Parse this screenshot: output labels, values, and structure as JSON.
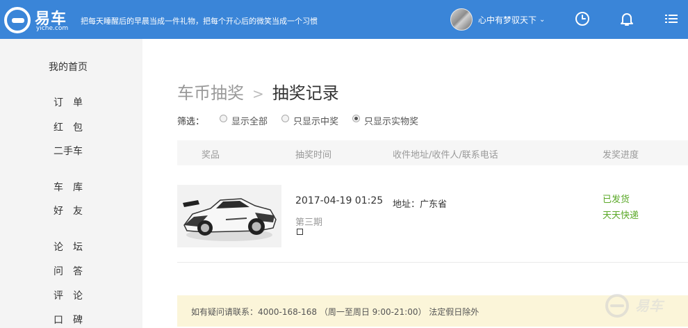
{
  "header": {
    "logo_text": "易车",
    "logo_sub": "yiche.com",
    "slogan": "把每天睡醒后的早晨当成一件礼物，把每个开心后的微笑当成一个习惯",
    "username": "心中有梦驭天下",
    "icons": [
      "clock-icon",
      "bell-icon",
      "menu-icon"
    ]
  },
  "sidebar": {
    "home": "我的首页",
    "items": [
      "订　单",
      "红　包",
      "二手车",
      "车　库",
      "好　友",
      "论　坛",
      "问　答",
      "评　论",
      "口　碑"
    ]
  },
  "breadcrumb": {
    "parent": "车币抽奖",
    "separator": ">",
    "current": "抽奖记录"
  },
  "filter": {
    "label": "筛选：",
    "options": [
      "显示全部",
      "只显示中奖",
      "只显示实物奖"
    ],
    "selected": "只显示实物奖"
  },
  "table": {
    "headers": [
      "奖品",
      "抽奖时间",
      "收件地址/收件人/联系电话",
      "发奖进度"
    ],
    "rows": [
      {
        "prize_image": "white-sports-car-model",
        "time": "2017-04-19 01:25",
        "issue": "第三期",
        "address": "地址：广东省",
        "status": "已发货",
        "courier": "天天快递"
      }
    ]
  },
  "notice": {
    "text": "如有疑问请联系：4000-168-168 （周一至周日 9:00-21:00） 法定假日除外"
  },
  "watermark": {
    "text": "易车"
  },
  "colors": {
    "topbar": "#3a85d8",
    "sidebar": "#f4f4f4",
    "status_green": "#5aa827",
    "notice_bg": "#fbf5d9"
  }
}
